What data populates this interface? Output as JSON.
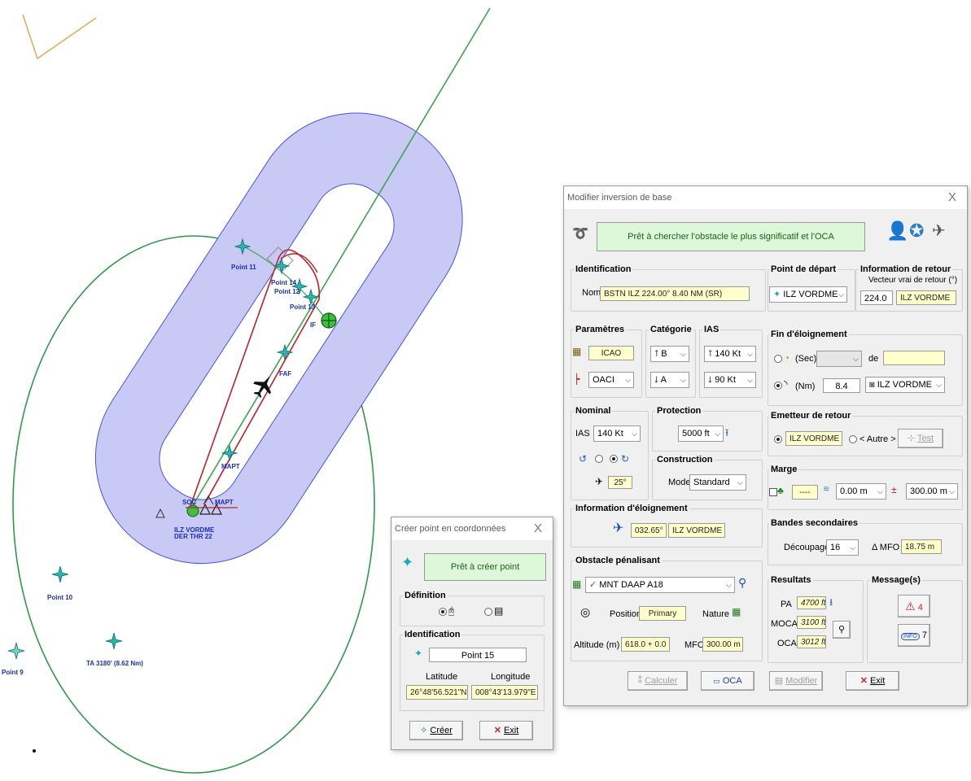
{
  "map": {
    "labels": {
      "point11": "Point 11",
      "point14": "Point 14",
      "point12": "Point 12",
      "point13": "Point 13",
      "if": "IF",
      "faf": "FAF",
      "mapt": "MAPT",
      "soc": "SOC",
      "mapt2": "MAPT",
      "ilz_vordme": "ILZ VORDME",
      "der_thr": "DER THR 22",
      "point10": "Point 10",
      "point9": "Point 9",
      "ta": "TA 3180' (8.62 Nm)"
    },
    "colors": {
      "protection_area": "#c8caf5",
      "protection_edge": "#4a52e0",
      "circle": "#2e9a4a",
      "track": "#3aa54a",
      "inbound": "#c0202a"
    }
  },
  "create_point_dialog": {
    "title": "Créer point en coordonnées",
    "close": "X",
    "status": "Prêt à créer point",
    "definition_label": "Définition",
    "identification_label": "Identification",
    "name_value": "Point 15",
    "latitude_label": "Latitude",
    "longitude_label": "Longitude",
    "latitude_value": "26°48'56.521\"N",
    "longitude_value": "008°43'13.979\"E",
    "create_button": "Créer",
    "exit_button": "Exit"
  },
  "main_dialog": {
    "title": "Modifier inversion de base",
    "close": "X",
    "status": "Prêt à chercher l'obstacle le plus significatif et l'OCA",
    "identification": {
      "label": "Identification",
      "name_label": "Nom",
      "name_value": "BSTN ILZ 224.00° 8.40 NM (SR)"
    },
    "point_depart": {
      "label": "Point de départ",
      "value": "ILZ VORDME"
    },
    "info_retour": {
      "label": "Information de retour",
      "sub": "Vecteur vrai de retour (°)",
      "value": "224.0",
      "station": "ILZ VORDME"
    },
    "parametres": {
      "label": "Paramètres",
      "value1": "ICAO",
      "value2": "OACI"
    },
    "categorie": {
      "label": "Catégorie",
      "upper": "B",
      "lower": "A"
    },
    "ias": {
      "label": "IAS",
      "upper": "140 Kt",
      "lower": "90 Kt"
    },
    "fin_eloignement": {
      "label": "Fin d'éloignement",
      "sec_label": "(Sec)",
      "de_label": "de",
      "nm_label": "(Nm)",
      "nm_value": "8.4",
      "station": "ILZ VORDME"
    },
    "nominal": {
      "label": "Nominal",
      "ias_label": "IAS",
      "ias_value": "140 Kt",
      "bank_value": "25°"
    },
    "protection": {
      "label": "Protection",
      "value": "5000 ft"
    },
    "construction": {
      "label": "Construction",
      "mode_label": "Mode",
      "mode_value": "Standard"
    },
    "emetteur": {
      "label": "Emetteur de retour",
      "station": "ILZ VORDME",
      "autre": "< Autre >",
      "test": "Test"
    },
    "marge": {
      "label": "Marge",
      "field1": "----",
      "field2": "0.00 m",
      "field3": "300.00 m"
    },
    "info_eloignement": {
      "label": "Information d'éloignement",
      "track": "032.65°",
      "station": "ILZ VORDME"
    },
    "bandes": {
      "label": "Bandes secondaires",
      "decoupage_label": "Découpage",
      "decoupage_value": "16",
      "mfo_label": "Δ MFO",
      "mfo_value": "18.75 m"
    },
    "obstacle": {
      "label": "Obstacle pénalisant",
      "value": "MNT DAAP A18",
      "position_label": "Position",
      "position_value": "Primary",
      "nature_label": "Nature",
      "altitude_label": "Altitude (m)",
      "altitude_value": "618.0 + 0.0",
      "mfo_label": "MFO",
      "mfo_value": "300.00 m"
    },
    "resultats": {
      "label": "Resultats",
      "pa_label": "PA",
      "pa_value": "4700 ft",
      "moca_label": "MOCA",
      "moca_value": "3100 ft",
      "oca_label": "OCA",
      "oca_value": "3012 ft"
    },
    "messages": {
      "label": "Message(s)",
      "warn_count": "4",
      "info_count": "7",
      "info_badge": "INFO"
    },
    "buttons": {
      "calculer": "Calculer",
      "oca": "OCA",
      "modifier": "Modifier",
      "exit": "Exit"
    }
  }
}
